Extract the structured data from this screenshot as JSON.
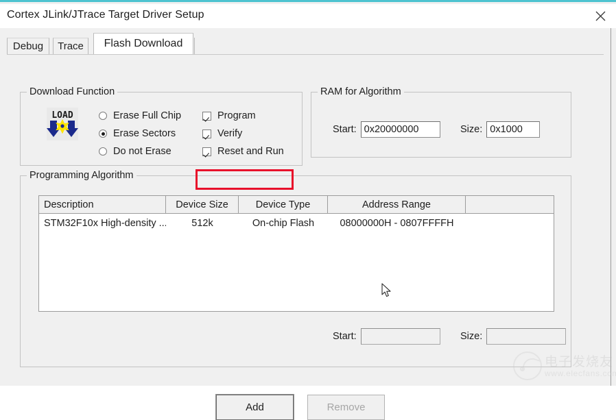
{
  "window": {
    "title": "Cortex JLink/JTrace Target Driver Setup",
    "close_icon": "close-icon",
    "accent_color": "#4ec3d0"
  },
  "tabs": [
    {
      "label": "Debug",
      "active": false
    },
    {
      "label": "Trace",
      "active": false
    },
    {
      "label": "Flash Download",
      "active": true
    }
  ],
  "download_function": {
    "legend": "Download Function",
    "icon_label": "LOAD",
    "radios": [
      {
        "label": "Erase Full Chip",
        "checked": false
      },
      {
        "label": "Erase Sectors",
        "checked": true
      },
      {
        "label": "Do not Erase",
        "checked": false
      }
    ],
    "checkboxes": [
      {
        "label": "Program",
        "checked": true
      },
      {
        "label": "Verify",
        "checked": true
      },
      {
        "label": "Reset and Run",
        "checked": true,
        "highlighted": true
      }
    ],
    "highlight_color": "#e8102a"
  },
  "ram_for_algorithm": {
    "legend": "RAM for Algorithm",
    "start_label": "Start:",
    "start_value": "0x20000000",
    "size_label": "Size:",
    "size_value": "0x1000"
  },
  "programming_algorithm": {
    "legend": "Programming Algorithm",
    "columns": [
      "Description",
      "Device Size",
      "Device Type",
      "Address Range",
      ""
    ],
    "rows": [
      {
        "description": "STM32F10x High-density ...",
        "device_size": "512k",
        "device_type": "On-chip Flash",
        "address_range": "08000000H - 0807FFFFH",
        "extra": ""
      }
    ],
    "start_label": "Start:",
    "start_value": "",
    "size_label": "Size:",
    "size_value": ""
  },
  "buttons": {
    "add": {
      "label": "Add",
      "enabled": true
    },
    "remove": {
      "label": "Remove",
      "enabled": false
    }
  },
  "watermark": {
    "text_cn": "电子发烧友",
    "url": "www.elecfans.com"
  }
}
